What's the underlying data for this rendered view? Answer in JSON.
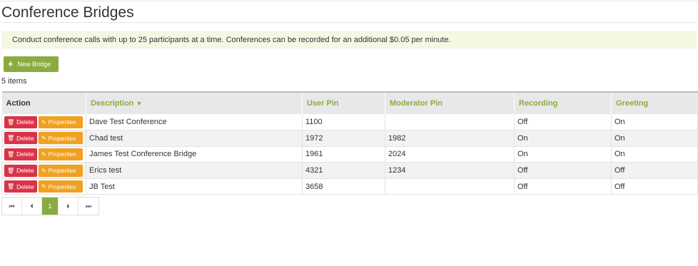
{
  "page": {
    "title": "Conference Bridges",
    "info": "Conduct conference calls with up to 25 participants at a time. Conferences can be recorded for an additional $0.05 per minute.",
    "new_button": "New Bridge",
    "item_count": "5 items"
  },
  "grid": {
    "columns": [
      "Action",
      "Description",
      "User Pin",
      "Moderator Pin",
      "Recording",
      "Greeting"
    ],
    "sort_column": "Description",
    "sort_direction": "descending",
    "delete_label": "Delete",
    "properties_label": "Properties",
    "rows": [
      {
        "description": "Dave Test Conference",
        "user_pin": "1100",
        "moderator_pin": "",
        "recording": "Off",
        "greeting": "On"
      },
      {
        "description": "Chad test",
        "user_pin": "1972",
        "moderator_pin": "1982",
        "recording": "On",
        "greeting": "On"
      },
      {
        "description": "James Test Conference Bridge",
        "user_pin": "1961",
        "moderator_pin": "2024",
        "recording": "On",
        "greeting": "On"
      },
      {
        "description": "Erics test",
        "user_pin": "4321",
        "moderator_pin": "1234",
        "recording": "Off",
        "greeting": "Off"
      },
      {
        "description": "JB Test",
        "user_pin": "3658",
        "moderator_pin": "",
        "recording": "Off",
        "greeting": "Off"
      }
    ]
  },
  "pager": {
    "current_page": "1",
    "first_icon": "first-page-icon",
    "prev_icon": "previous-page-icon",
    "next_icon": "next-page-icon",
    "last_icon": "last-page-icon"
  },
  "colors": {
    "accent": "#8aac3f",
    "delete": "#d9334a",
    "properties": "#f0a120",
    "info_bg": "#f3f8e3"
  }
}
